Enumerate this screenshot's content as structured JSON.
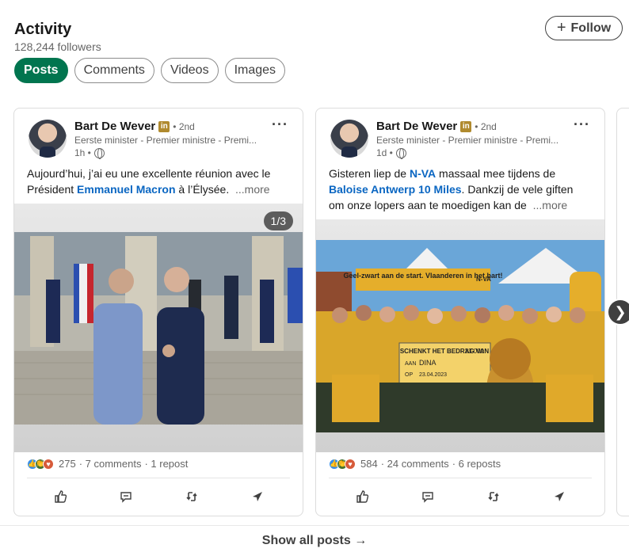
{
  "header": {
    "title": "Activity",
    "followers": "128,244 followers",
    "follow_label": "Follow"
  },
  "tabs": [
    {
      "label": "Posts",
      "active": true
    },
    {
      "label": "Comments",
      "active": false
    },
    {
      "label": "Videos",
      "active": false
    },
    {
      "label": "Images",
      "active": false
    }
  ],
  "posts": [
    {
      "author": "Bart De Wever",
      "badge": "in",
      "degree": "• 2nd",
      "headline": "Eerste minister - Premier ministre - Premi...",
      "time": "1h •",
      "text_parts": {
        "pre": "Aujourd’hui, j’ai eu une excellente réunion avec le Président ",
        "link1": "Emmanuel Macron",
        "post": " à l’Élysée.",
        "more": "...more"
      },
      "media_counter": "1/3",
      "reactions": "275",
      "comments": "· 7 comments",
      "reposts": "· 1 repost"
    },
    {
      "author": "Bart De Wever",
      "badge": "in",
      "degree": "• 2nd",
      "headline": "Eerste minister - Premier ministre - Premi...",
      "time": "1d •",
      "text_parts": {
        "pre": "Gisteren liep de ",
        "link1": "N-VA",
        "mid": " massaal mee tijdens de ",
        "link2": "Baloise Antwerp 10 Miles",
        "post": ". Dankzij de vele giften om onze lopers aan te moedigen kan de",
        "more": "...more"
      },
      "reactions": "584",
      "comments": "· 24 comments",
      "reposts": "· 6 reposts"
    }
  ],
  "photo2_text": {
    "banner": "Geel-zwart aan de start. Vlaanderen in het hart!",
    "logo": "N-VA",
    "cheque_title": "SCHENKT HET BEDRAG VAN",
    "cheque_amount": "23.000",
    "cheque_to_label": "AAN",
    "cheque_to": "DINA",
    "cheque_date_label": "OP",
    "cheque_date": "23.04.2023"
  },
  "footer": {
    "show_all": "Show all posts →"
  }
}
